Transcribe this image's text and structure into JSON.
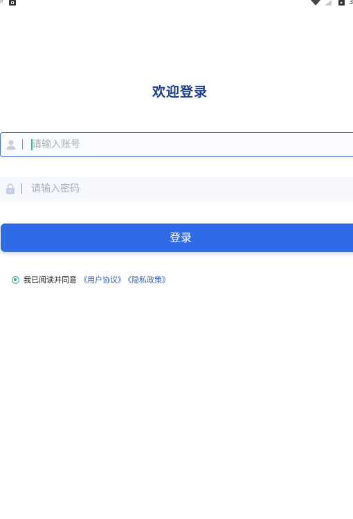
{
  "status_bar": {
    "left_glyph": "P",
    "time": "3",
    "icons": [
      "notification-icon",
      "wifi-icon",
      "signal-icon",
      "battery-icon"
    ]
  },
  "title": "欢迎登录",
  "account": {
    "placeholder": "请输入账号",
    "value": "",
    "icon": "user-icon"
  },
  "password": {
    "placeholder": "请输入密码",
    "value": "",
    "icon": "lock-icon"
  },
  "login_label": "登录",
  "agreement": {
    "checked": true,
    "text": "我已阅读并同意",
    "user_agreement": "《用户协议》",
    "privacy_policy": "《隐私政策》"
  },
  "colors": {
    "title": "#1a3d8f",
    "accent": "#2f6be6",
    "link": "#2f5fc4",
    "check": "#21b39a"
  }
}
